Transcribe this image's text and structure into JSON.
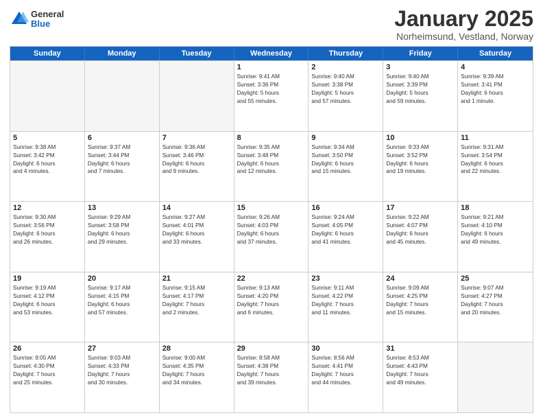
{
  "logo": {
    "general": "General",
    "blue": "Blue"
  },
  "title": "January 2025",
  "subtitle": "Norheimsund, Vestland, Norway",
  "header_days": [
    "Sunday",
    "Monday",
    "Tuesday",
    "Wednesday",
    "Thursday",
    "Friday",
    "Saturday"
  ],
  "weeks": [
    [
      {
        "day": "",
        "info": ""
      },
      {
        "day": "",
        "info": ""
      },
      {
        "day": "",
        "info": ""
      },
      {
        "day": "1",
        "info": "Sunrise: 9:41 AM\nSunset: 3:36 PM\nDaylight: 5 hours\nand 55 minutes."
      },
      {
        "day": "2",
        "info": "Sunrise: 9:40 AM\nSunset: 3:38 PM\nDaylight: 5 hours\nand 57 minutes."
      },
      {
        "day": "3",
        "info": "Sunrise: 9:40 AM\nSunset: 3:39 PM\nDaylight: 5 hours\nand 59 minutes."
      },
      {
        "day": "4",
        "info": "Sunrise: 9:39 AM\nSunset: 3:41 PM\nDaylight: 6 hours\nand 1 minute."
      }
    ],
    [
      {
        "day": "5",
        "info": "Sunrise: 9:38 AM\nSunset: 3:42 PM\nDaylight: 6 hours\nand 4 minutes."
      },
      {
        "day": "6",
        "info": "Sunrise: 9:37 AM\nSunset: 3:44 PM\nDaylight: 6 hours\nand 7 minutes."
      },
      {
        "day": "7",
        "info": "Sunrise: 9:36 AM\nSunset: 3:46 PM\nDaylight: 6 hours\nand 9 minutes."
      },
      {
        "day": "8",
        "info": "Sunrise: 9:35 AM\nSunset: 3:48 PM\nDaylight: 6 hours\nand 12 minutes."
      },
      {
        "day": "9",
        "info": "Sunrise: 9:34 AM\nSunset: 3:50 PM\nDaylight: 6 hours\nand 15 minutes."
      },
      {
        "day": "10",
        "info": "Sunrise: 9:33 AM\nSunset: 3:52 PM\nDaylight: 6 hours\nand 19 minutes."
      },
      {
        "day": "11",
        "info": "Sunrise: 9:31 AM\nSunset: 3:54 PM\nDaylight: 6 hours\nand 22 minutes."
      }
    ],
    [
      {
        "day": "12",
        "info": "Sunrise: 9:30 AM\nSunset: 3:56 PM\nDaylight: 6 hours\nand 26 minutes."
      },
      {
        "day": "13",
        "info": "Sunrise: 9:29 AM\nSunset: 3:58 PM\nDaylight: 6 hours\nand 29 minutes."
      },
      {
        "day": "14",
        "info": "Sunrise: 9:27 AM\nSunset: 4:01 PM\nDaylight: 6 hours\nand 33 minutes."
      },
      {
        "day": "15",
        "info": "Sunrise: 9:26 AM\nSunset: 4:03 PM\nDaylight: 6 hours\nand 37 minutes."
      },
      {
        "day": "16",
        "info": "Sunrise: 9:24 AM\nSunset: 4:05 PM\nDaylight: 6 hours\nand 41 minutes."
      },
      {
        "day": "17",
        "info": "Sunrise: 9:22 AM\nSunset: 4:07 PM\nDaylight: 6 hours\nand 45 minutes."
      },
      {
        "day": "18",
        "info": "Sunrise: 9:21 AM\nSunset: 4:10 PM\nDaylight: 6 hours\nand 49 minutes."
      }
    ],
    [
      {
        "day": "19",
        "info": "Sunrise: 9:19 AM\nSunset: 4:12 PM\nDaylight: 6 hours\nand 53 minutes."
      },
      {
        "day": "20",
        "info": "Sunrise: 9:17 AM\nSunset: 4:15 PM\nDaylight: 6 hours\nand 57 minutes."
      },
      {
        "day": "21",
        "info": "Sunrise: 9:15 AM\nSunset: 4:17 PM\nDaylight: 7 hours\nand 2 minutes."
      },
      {
        "day": "22",
        "info": "Sunrise: 9:13 AM\nSunset: 4:20 PM\nDaylight: 7 hours\nand 6 minutes."
      },
      {
        "day": "23",
        "info": "Sunrise: 9:11 AM\nSunset: 4:22 PM\nDaylight: 7 hours\nand 11 minutes."
      },
      {
        "day": "24",
        "info": "Sunrise: 9:09 AM\nSunset: 4:25 PM\nDaylight: 7 hours\nand 15 minutes."
      },
      {
        "day": "25",
        "info": "Sunrise: 9:07 AM\nSunset: 4:27 PM\nDaylight: 7 hours\nand 20 minutes."
      }
    ],
    [
      {
        "day": "26",
        "info": "Sunrise: 9:05 AM\nSunset: 4:30 PM\nDaylight: 7 hours\nand 25 minutes."
      },
      {
        "day": "27",
        "info": "Sunrise: 9:03 AM\nSunset: 4:33 PM\nDaylight: 7 hours\nand 30 minutes."
      },
      {
        "day": "28",
        "info": "Sunrise: 9:00 AM\nSunset: 4:35 PM\nDaylight: 7 hours\nand 34 minutes."
      },
      {
        "day": "29",
        "info": "Sunrise: 8:58 AM\nSunset: 4:38 PM\nDaylight: 7 hours\nand 39 minutes."
      },
      {
        "day": "30",
        "info": "Sunrise: 8:56 AM\nSunset: 4:41 PM\nDaylight: 7 hours\nand 44 minutes."
      },
      {
        "day": "31",
        "info": "Sunrise: 8:53 AM\nSunset: 4:43 PM\nDaylight: 7 hours\nand 49 minutes."
      },
      {
        "day": "",
        "info": ""
      }
    ]
  ]
}
